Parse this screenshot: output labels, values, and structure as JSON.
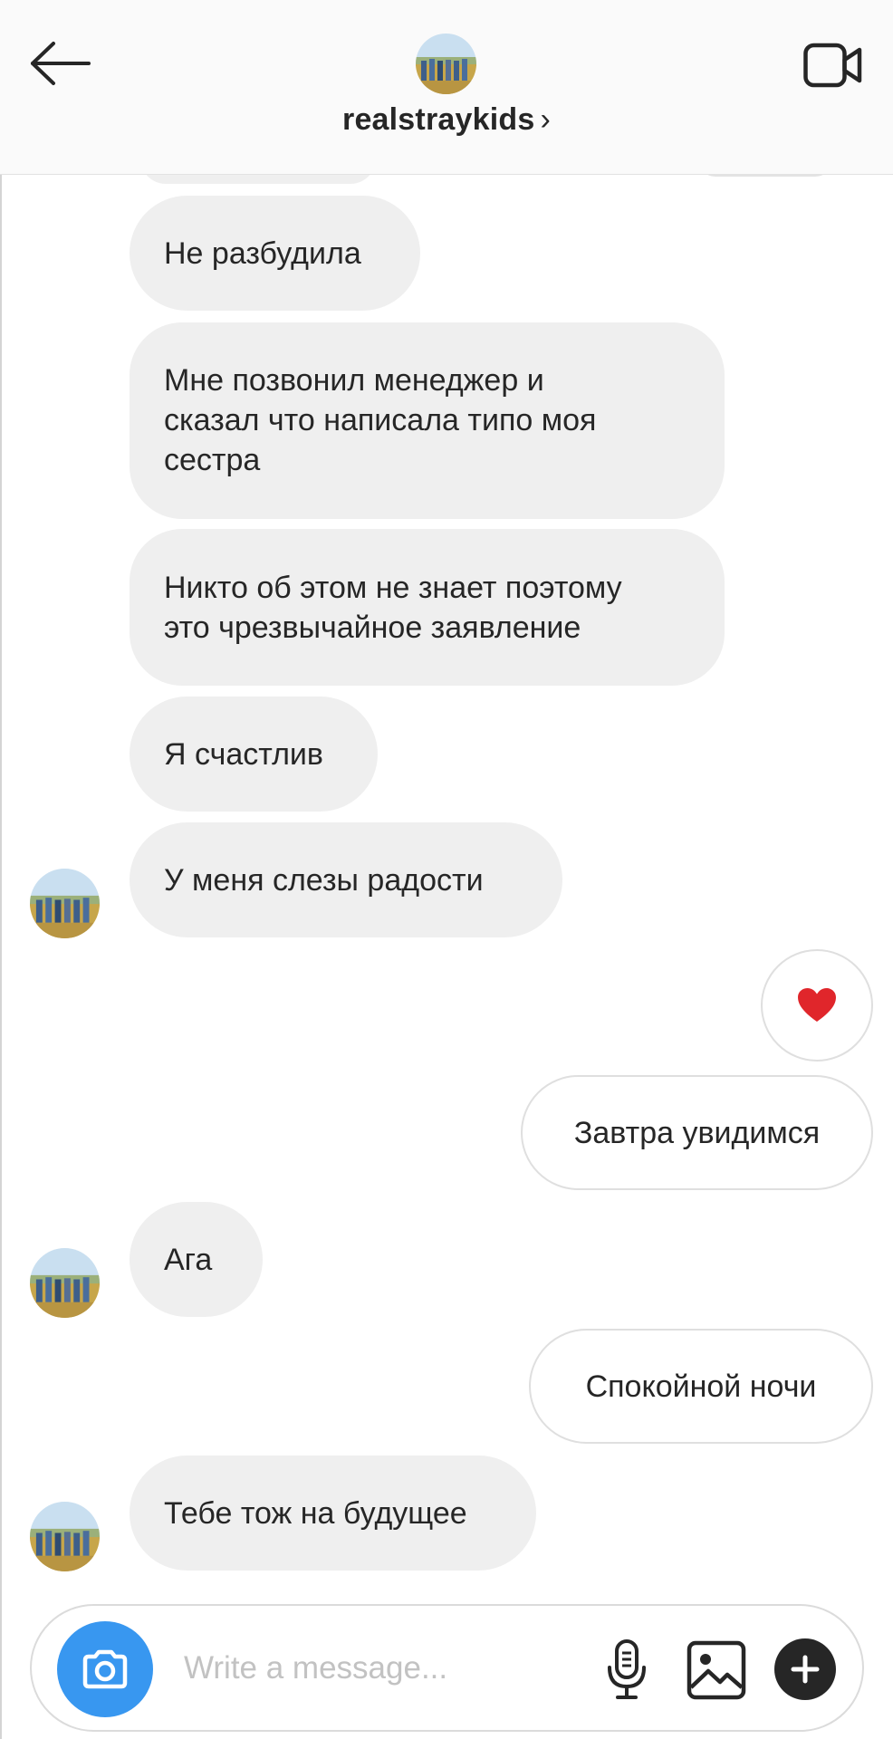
{
  "header": {
    "username": "realstraykids",
    "chevron": "›",
    "back_icon": "arrow-left-icon",
    "video_icon": "video-call-icon"
  },
  "messages": [
    {
      "direction": "incoming",
      "text": "Не разбудила",
      "avatar": false
    },
    {
      "direction": "incoming",
      "lines": [
        "Мне позвонил менеджер и",
        "сказал что написала типо моя",
        "сестра"
      ],
      "avatar": false
    },
    {
      "direction": "incoming",
      "lines": [
        "Никто об этом не знает поэтому",
        "это чрезвычайное заявление"
      ],
      "avatar": false
    },
    {
      "direction": "incoming",
      "text": "Я счастлив",
      "avatar": false
    },
    {
      "direction": "incoming",
      "text": "У меня слезы радости",
      "avatar": true
    },
    {
      "direction": "outgoing",
      "text": "❤️",
      "type": "heart"
    },
    {
      "direction": "outgoing",
      "text": "Завтра увидимся"
    },
    {
      "direction": "incoming",
      "text": "Ага",
      "avatar": true
    },
    {
      "direction": "outgoing",
      "text": "Спокойной ночи"
    },
    {
      "direction": "incoming",
      "text": "Тебе тож на будущее",
      "avatar": true
    }
  ],
  "composer": {
    "placeholder": "Write a message...",
    "camera_icon": "camera-icon",
    "mic_icon": "microphone-icon",
    "gallery_icon": "image-gallery-icon",
    "plus_icon": "plus-icon"
  },
  "colors": {
    "accent": "#3897f0",
    "incoming_bubble": "#efefef",
    "outgoing_border": "#dfdfdf",
    "heart": "#e0262b"
  }
}
